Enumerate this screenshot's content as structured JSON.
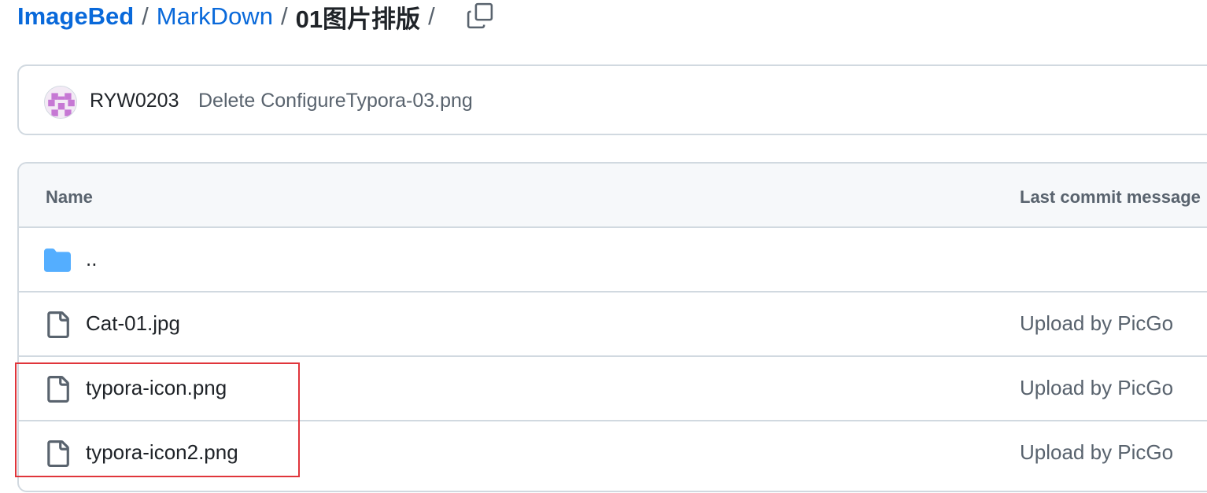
{
  "breadcrumb": {
    "items": [
      {
        "label": "ImageBed"
      },
      {
        "label": "MarkDown"
      }
    ],
    "separator": "/",
    "current": "01图片排版",
    "copy_icon": "copy-icon"
  },
  "commit": {
    "author": "RYW0203",
    "message": "Delete ConfigureTypora-03.png",
    "avatar_icon": "identicon-avatar"
  },
  "table": {
    "headers": {
      "name": "Name",
      "last_commit": "Last commit message"
    },
    "rows": [
      {
        "name": "..",
        "commit": "",
        "icon": "folder-icon",
        "type": "parent-dir"
      },
      {
        "name": "Cat-01.jpg",
        "commit": "Upload by PicGo",
        "icon": "file-icon",
        "type": "file"
      },
      {
        "name": "typora-icon.png",
        "commit": "Upload by PicGo",
        "icon": "file-icon",
        "type": "file"
      },
      {
        "name": "typora-icon2.png",
        "commit": "Upload by PicGo",
        "icon": "file-icon",
        "type": "file"
      }
    ]
  },
  "colors": {
    "link": "#0969da",
    "muted": "#59636e",
    "border": "#d1d9e0",
    "folder": "#54aeff",
    "highlight": "#e0353b",
    "avatar": "#c678d4"
  }
}
